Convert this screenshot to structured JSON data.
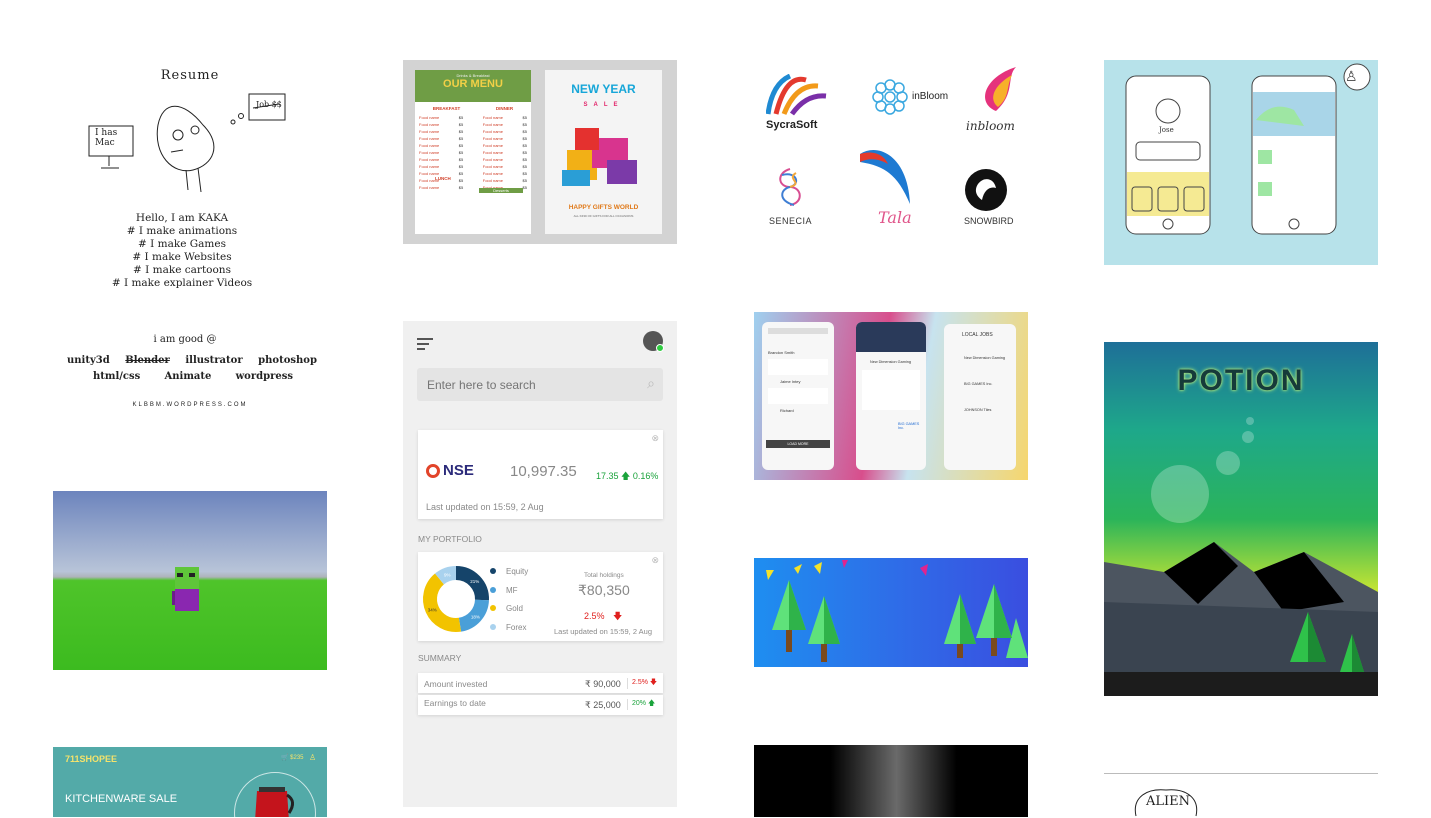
{
  "resume": {
    "title": "Resume",
    "mac_note": "I has Mac",
    "job_note": "Job $$",
    "lines": [
      "Hello, I am KAKA",
      "# I make animations",
      "# I make Games",
      "# I make Websites",
      "# I make cartoons",
      "# I make explainer Videos"
    ],
    "good_at": "i am good @",
    "skills_row1": [
      "unity3d",
      "Blender",
      "illustrator",
      "photoshop"
    ],
    "skills_row2": [
      "html/css",
      "Animate",
      "wordpress"
    ],
    "site": "KLBBM.WORDPRESS.COM"
  },
  "menu_flyer": {
    "tag": "Drinks & Breakfast",
    "title": "OUR MENU",
    "sections": [
      "BREAKFAST",
      "DINNER",
      "LUNCH",
      "Desserts"
    ],
    "item_label": "Food name",
    "price": "$5"
  },
  "ny_flyer": {
    "title": "NEW YEAR",
    "sale": "SALE",
    "subtitle": "HAPPY GIFTS WORLD",
    "fine": "ALL KIND OF GIFTS FOR ALL OCCASIONS"
  },
  "logos": [
    "SycraSoft",
    "inBloom",
    "inbloom",
    "SENECIA",
    "Tala",
    "SNOWBIRD"
  ],
  "wire": {
    "name": "Jose"
  },
  "dashboard": {
    "search_placeholder": "Enter here to search",
    "nse": {
      "label": "NSE",
      "value": "10,997.35",
      "change": "17.35",
      "change_pct": "0.16%",
      "updated": "Last updated on 15:59, 2 Aug"
    },
    "portfolio_heading": "MY PORTFOLIO",
    "portfolio": {
      "legend": [
        "Equity",
        "MF",
        "Gold",
        "Forex"
      ],
      "donut_labels": [
        "21%",
        "18%",
        "34%",
        "9%"
      ],
      "total_label": "Total holdings",
      "total_value": "₹80,350",
      "change_pct": "2.5%",
      "updated": "Last updated on 15:59, 2 Aug",
      "colors": [
        "#15446a",
        "#4a9fd8",
        "#f2c300",
        "#a9d2ee"
      ]
    },
    "summary_heading": "SUMMARY",
    "summary": [
      {
        "label": "Amount invested",
        "value": "₹ 90,000",
        "pct": "2.5%",
        "dir": "down"
      },
      {
        "label": "Earnings to date",
        "value": "₹ 25,000",
        "pct": "20%",
        "dir": "up"
      }
    ]
  },
  "jobs": {
    "col3_title": "LOCAL JOBS",
    "companies": [
      "New Dimension Gaming",
      "BIG GAMES Inc.",
      "JOHNSON Tiles",
      "BIG GAMES Inc."
    ],
    "people": [
      "Brandon Smith",
      "Jaime Intey",
      "Richard"
    ],
    "load_more": "LOAD MORE"
  },
  "potion": {
    "title": "POTION"
  },
  "shop": {
    "brand": "711SHOPEE",
    "cart": "$235",
    "headline": "KITCHENWARE SALE"
  },
  "alien": {
    "label": "ALIEN"
  }
}
